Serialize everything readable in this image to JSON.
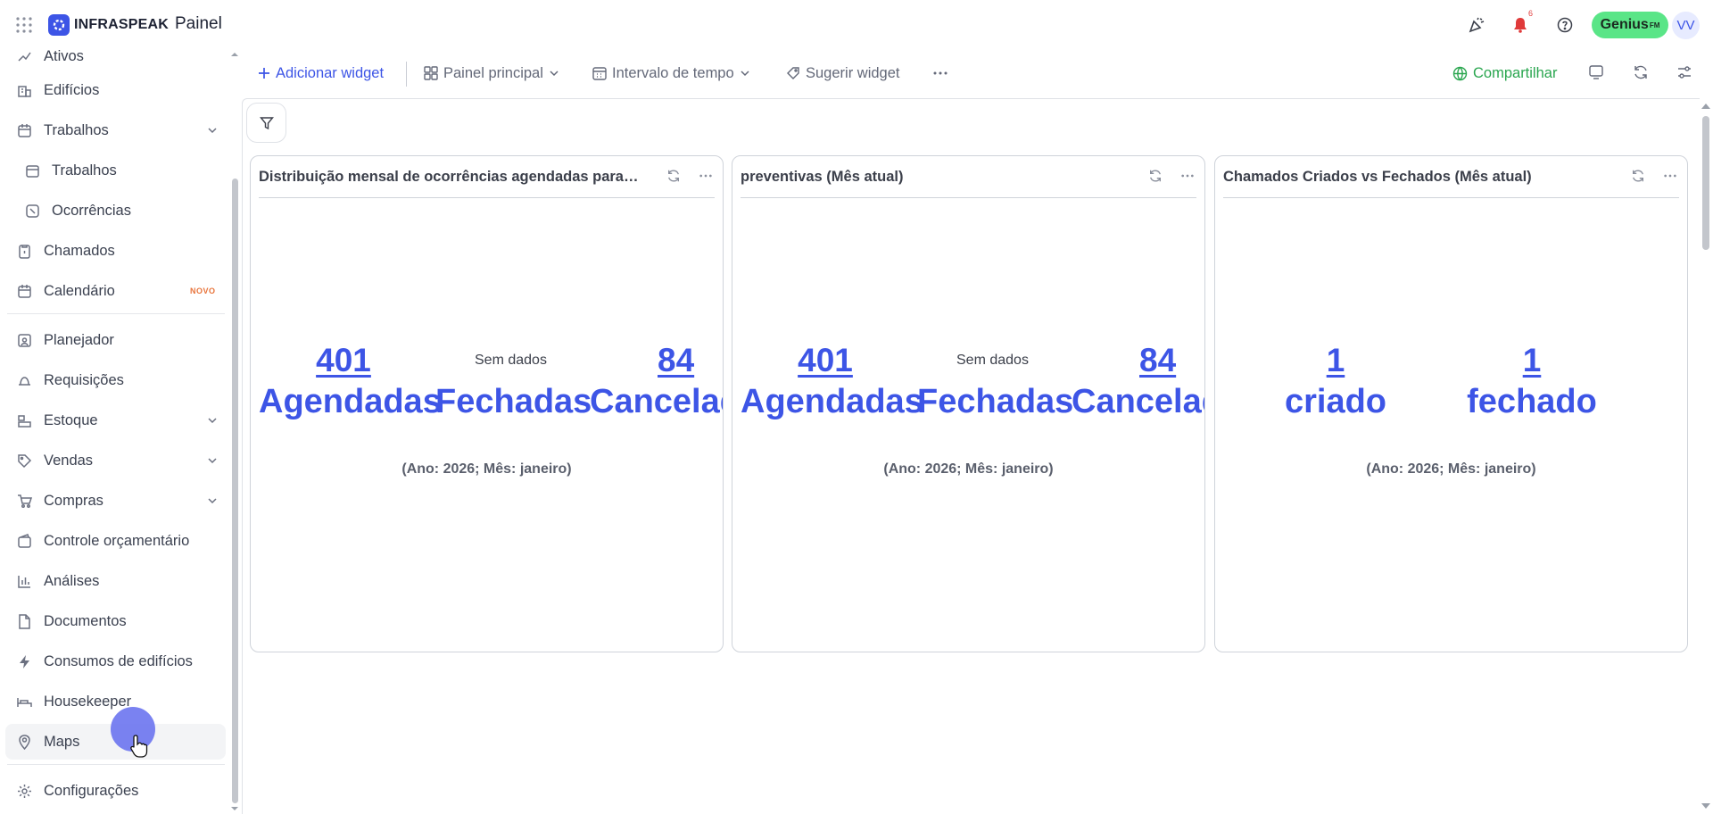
{
  "header": {
    "logo_text": "INFRASPEAK",
    "page_title": "Painel",
    "notification_count": "6",
    "genius_label": "Genius",
    "genius_suffix": "FM",
    "avatar_initials": "VV"
  },
  "sidebar": {
    "items": [
      {
        "label": "Ativos",
        "icon": "assets-icon"
      },
      {
        "label": "Edifícios",
        "icon": "building-icon"
      },
      {
        "label": "Trabalhos",
        "icon": "calendar-icon"
      },
      {
        "label": "Trabalhos",
        "icon": "calendar-icon"
      },
      {
        "label": "Ocorrências",
        "icon": "occurrence-icon"
      },
      {
        "label": "Chamados",
        "icon": "clipboard-icon"
      },
      {
        "label": "Calendário",
        "icon": "calendar-icon",
        "badge": "NOVO"
      },
      {
        "label": "Planejador",
        "icon": "planner-icon"
      },
      {
        "label": "Requisições",
        "icon": "bell-icon"
      },
      {
        "label": "Estoque",
        "icon": "stock-icon"
      },
      {
        "label": "Vendas",
        "icon": "tag-icon"
      },
      {
        "label": "Compras",
        "icon": "cart-icon"
      },
      {
        "label": "Controle orçamentário",
        "icon": "wallet-icon"
      },
      {
        "label": "Análises",
        "icon": "bar-chart-icon"
      },
      {
        "label": "Documentos",
        "icon": "document-icon"
      },
      {
        "label": "Consumos de edifícios",
        "icon": "bolt-icon"
      },
      {
        "label": "Housekeeper",
        "icon": "bed-icon"
      },
      {
        "label": "Maps",
        "icon": "map-pin-icon"
      },
      {
        "label": "Configurações",
        "icon": "gear-icon"
      }
    ]
  },
  "toolbar": {
    "add_widget": "Adicionar widget",
    "dashboard": "Painel principal",
    "time_range": "Intervalo de tempo",
    "suggest_widget": "Sugerir widget",
    "share": "Compartilhar"
  },
  "cards": [
    {
      "title": "Distribuição mensal de ocorrências agendadas para o i...",
      "metrics": [
        {
          "value": "401",
          "label": "Agendadas"
        },
        {
          "value": "84",
          "label": "Canceladas"
        }
      ],
      "middle_label": "Fechadas",
      "no_data": "Sem dados",
      "period": "(Ano: 2026; Mês: janeiro)"
    },
    {
      "title": "preventivas (Mês atual)",
      "metrics": [
        {
          "value": "401",
          "label": "Agendadas"
        },
        {
          "value": "84",
          "label": "Canceladas"
        }
      ],
      "middle_label": "Fechadas",
      "no_data": "Sem dados",
      "period": "(Ano: 2026; Mês: janeiro)"
    },
    {
      "title": "Chamados Criados vs Fechados (Mês atual)",
      "metrics": [
        {
          "value": "1",
          "label": "criado"
        },
        {
          "value": "1",
          "label": "fechado"
        }
      ],
      "period": "(Ano: 2026; Mês: janeiro)"
    }
  ],
  "colors": {
    "brand": "#3d55e6",
    "share": "#2aa64f",
    "genius": "#5ae587",
    "alert": "#e03a3a"
  }
}
